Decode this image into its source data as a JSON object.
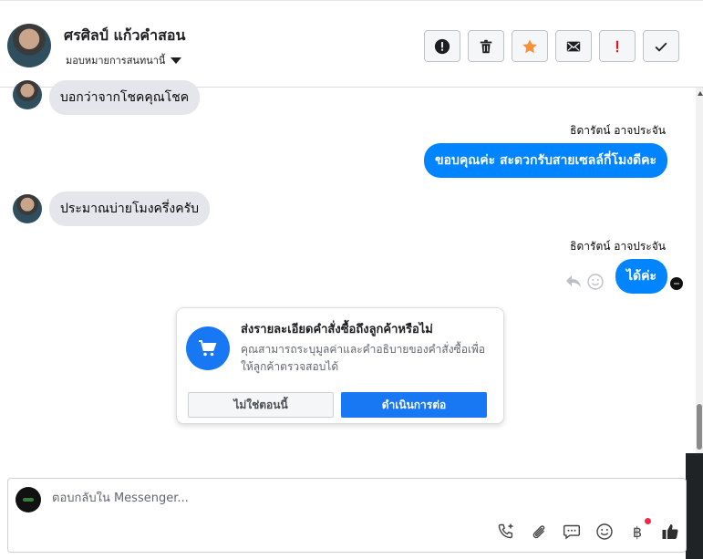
{
  "header": {
    "contact_name": "ศรศิลป์ แก้วคำสอน",
    "assign_label": "มอบหมายการสนทนานี้",
    "toolbar": [
      {
        "name": "report-spam-button",
        "icon": "alert-circle-icon"
      },
      {
        "name": "delete-button",
        "icon": "trash-icon"
      },
      {
        "name": "star-button",
        "icon": "star-icon"
      },
      {
        "name": "mark-unread-button",
        "icon": "envelope-icon"
      },
      {
        "name": "flag-button",
        "icon": "exclamation-icon"
      },
      {
        "name": "mark-done-button",
        "icon": "check-icon"
      }
    ]
  },
  "thread": {
    "messages": [
      {
        "direction": "in",
        "text": "บอกว่าจากโชคคุณโชค"
      },
      {
        "direction": "out",
        "sender": "ธิดารัตน์ อาจประจัน",
        "text": "ขอบคุณค่ะ สะดวกรับสายเซลล์กี่โมงดีคะ"
      },
      {
        "direction": "in",
        "text": "ประมาณบ่ายโมงครึ่งครับ"
      },
      {
        "direction": "out",
        "sender": "ธิดารัตน์ อาจประจัน",
        "text": "ได้ค่ะ"
      }
    ]
  },
  "order_card": {
    "title": "ส่งรายละเอียดคำสั่งซื้อถึงลูกค้าหรือไม่",
    "description": "คุณสามารถระบุมูลค่าและคำอธิบายของคำสั่งซื้อเพื่อให้ลูกค้าตรวจสอบได้",
    "secondary_label": "ไม่ใช่ตอนนี้",
    "primary_label": "ดำเนินการต่อ"
  },
  "composer": {
    "placeholder": "ตอบกลับใน Messenger...",
    "value": "",
    "currency_symbol": "฿"
  },
  "colors": {
    "brand_blue": "#1877f2",
    "outgoing_bubble": "#0084ff",
    "incoming_bubble": "#e4e6eb",
    "star": "#f7923b",
    "flag": "#e4151f"
  }
}
